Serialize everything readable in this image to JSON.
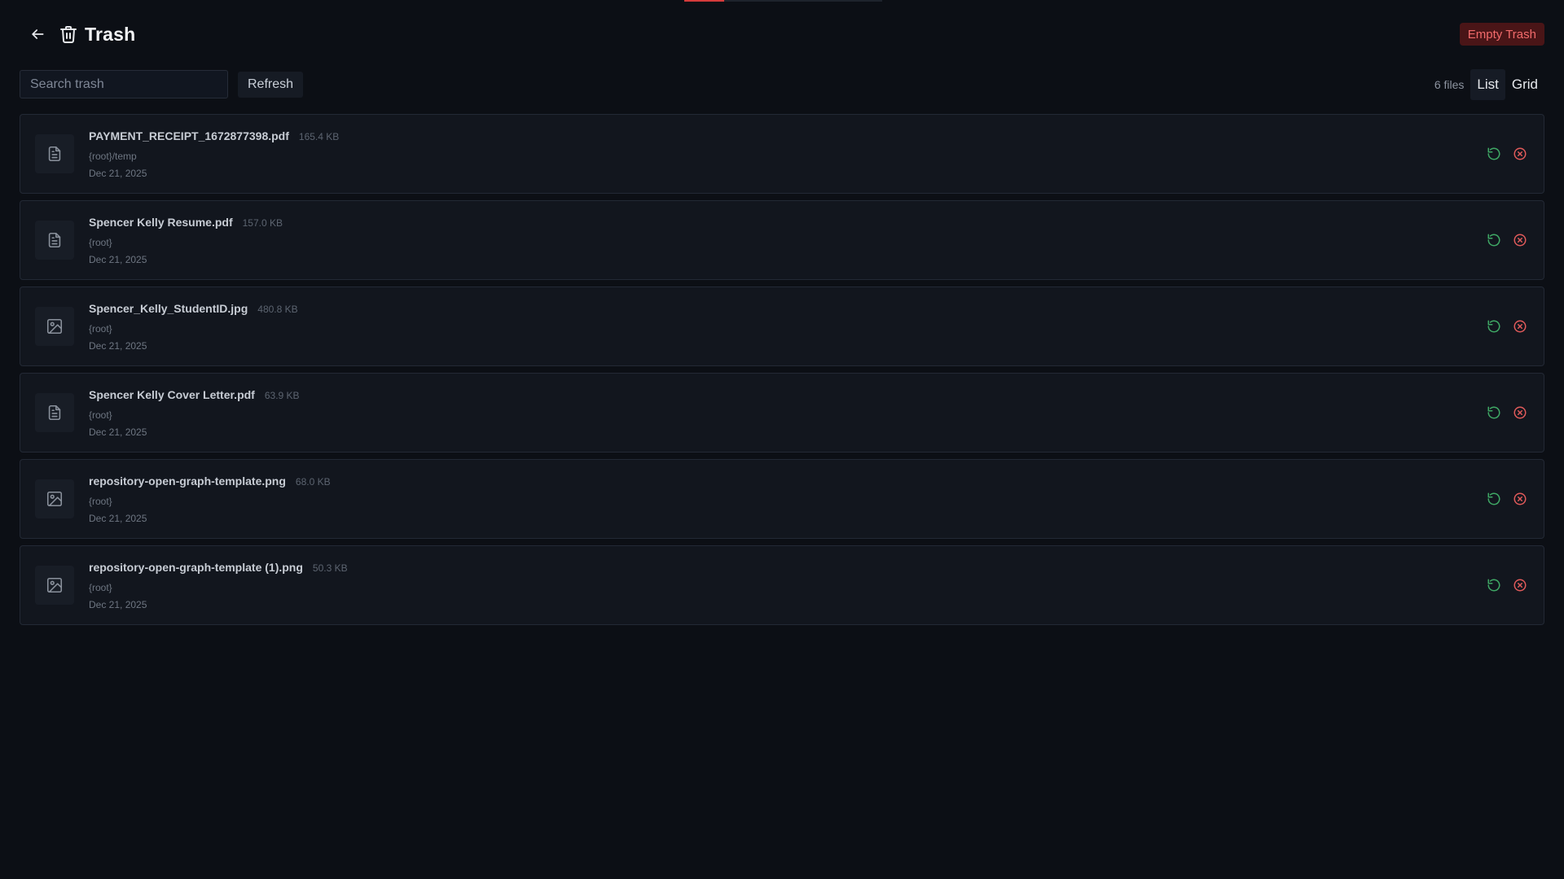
{
  "header": {
    "title": "Trash",
    "empty_trash_label": "Empty Trash",
    "back_icon": "arrow-left-icon",
    "title_icon": "trash-icon"
  },
  "toolbar": {
    "search_placeholder": "Search trash",
    "search_value": "",
    "refresh_label": "Refresh",
    "file_count": "6 files",
    "view_list_label": "List",
    "view_grid_label": "Grid",
    "active_view": "List"
  },
  "colors": {
    "background": "#0c0f15",
    "card": "#12161e",
    "danger": "#e05a5a",
    "restore": "#3fa865"
  },
  "files": [
    {
      "name": "PAYMENT_RECEIPT_1672877398.pdf",
      "size": "165.4 KB",
      "path": "{root}/temp",
      "date": "Dec 21, 2025",
      "icon": "document-icon"
    },
    {
      "name": "Spencer Kelly Resume.pdf",
      "size": "157.0 KB",
      "path": "{root}",
      "date": "Dec 21, 2025",
      "icon": "document-icon"
    },
    {
      "name": "Spencer_Kelly_StudentID.jpg",
      "size": "480.8 KB",
      "path": "{root}",
      "date": "Dec 21, 2025",
      "icon": "image-icon"
    },
    {
      "name": "Spencer Kelly Cover Letter.pdf",
      "size": "63.9 KB",
      "path": "{root}",
      "date": "Dec 21, 2025",
      "icon": "document-icon"
    },
    {
      "name": "repository-open-graph-template.png",
      "size": "68.0 KB",
      "path": "{root}",
      "date": "Dec 21, 2025",
      "icon": "image-icon"
    },
    {
      "name": "repository-open-graph-template (1).png",
      "size": "50.3 KB",
      "path": "{root}",
      "date": "Dec 21, 2025",
      "icon": "image-icon"
    }
  ]
}
